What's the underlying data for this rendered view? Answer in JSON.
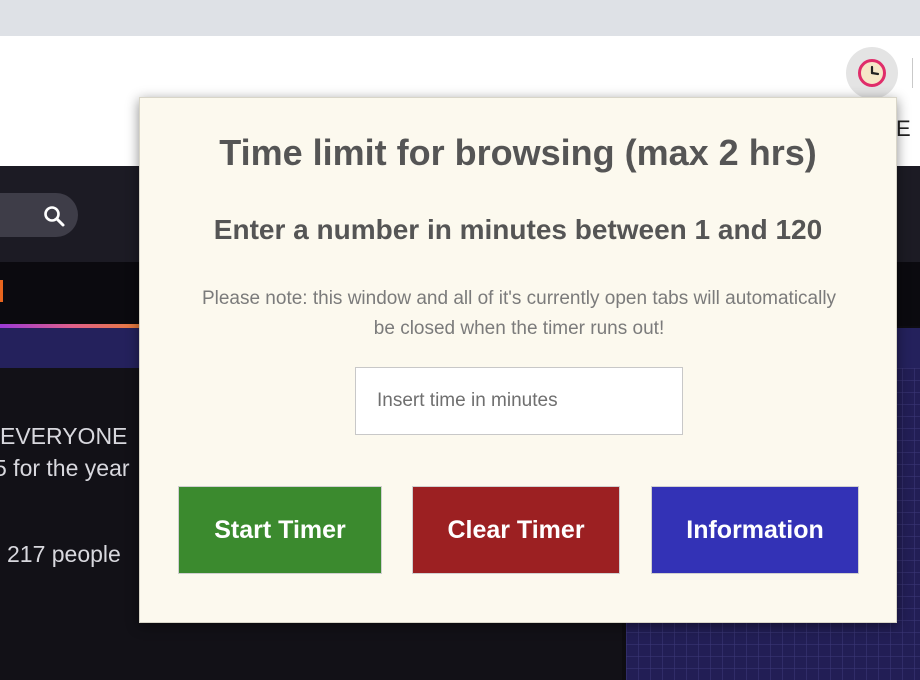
{
  "browser": {
    "extension_icon": "clock-icon",
    "partial_label": "E"
  },
  "background_page": {
    "search_icon": "search-icon",
    "text_lines": [
      "EVERYONE",
      "5 for the year",
      "217 people"
    ]
  },
  "popup": {
    "title": "Time limit for browsing (max 2 hrs)",
    "subtitle": "Enter a number in minutes between 1 and 120",
    "note": "Please note: this window and all of it's currently open tabs will automatically be closed when the timer runs out!",
    "input": {
      "placeholder": "Insert time in minutes",
      "value": ""
    },
    "buttons": {
      "start": "Start Timer",
      "clear": "Clear Timer",
      "info": "Information"
    }
  },
  "colors": {
    "popup_bg": "#fcf9ee",
    "start_button": "#3b8a2e",
    "clear_button": "#9c2022",
    "info_button": "#3332b6",
    "heading_text": "#555555"
  }
}
